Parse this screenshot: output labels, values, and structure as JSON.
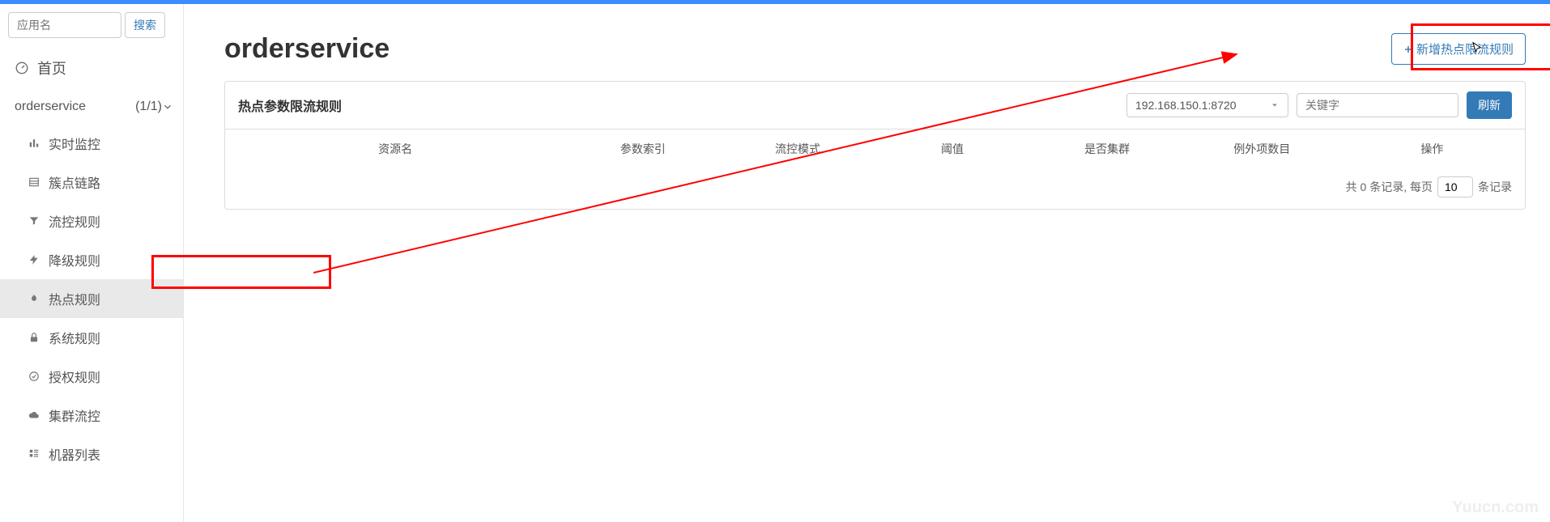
{
  "search": {
    "placeholder": "应用名",
    "button": "搜索"
  },
  "sidebar": {
    "home": "首页",
    "group": {
      "name": "orderservice",
      "count": "(1/1)"
    },
    "items": [
      {
        "label": "实时监控"
      },
      {
        "label": "簇点链路"
      },
      {
        "label": "流控规则"
      },
      {
        "label": "降级规则"
      },
      {
        "label": "热点规则"
      },
      {
        "label": "系统规则"
      },
      {
        "label": "授权规则"
      },
      {
        "label": "集群流控"
      },
      {
        "label": "机器列表"
      }
    ]
  },
  "page": {
    "title": "orderservice",
    "add_button": "新增热点限流规则"
  },
  "panel": {
    "title": "热点参数限流规则",
    "instance": "192.168.150.1:8720",
    "keyword_placeholder": "关键字",
    "refresh": "刷新",
    "columns": {
      "resource": "资源名",
      "index": "参数索引",
      "mode": "流控模式",
      "threshold": "阈值",
      "cluster": "是否集群",
      "exceptions": "例外项数目",
      "actions": "操作"
    },
    "pager": {
      "prefix": "共 0 条记录, 每页",
      "value": "10",
      "suffix": "条记录"
    }
  },
  "watermark": "Yuucn.com"
}
